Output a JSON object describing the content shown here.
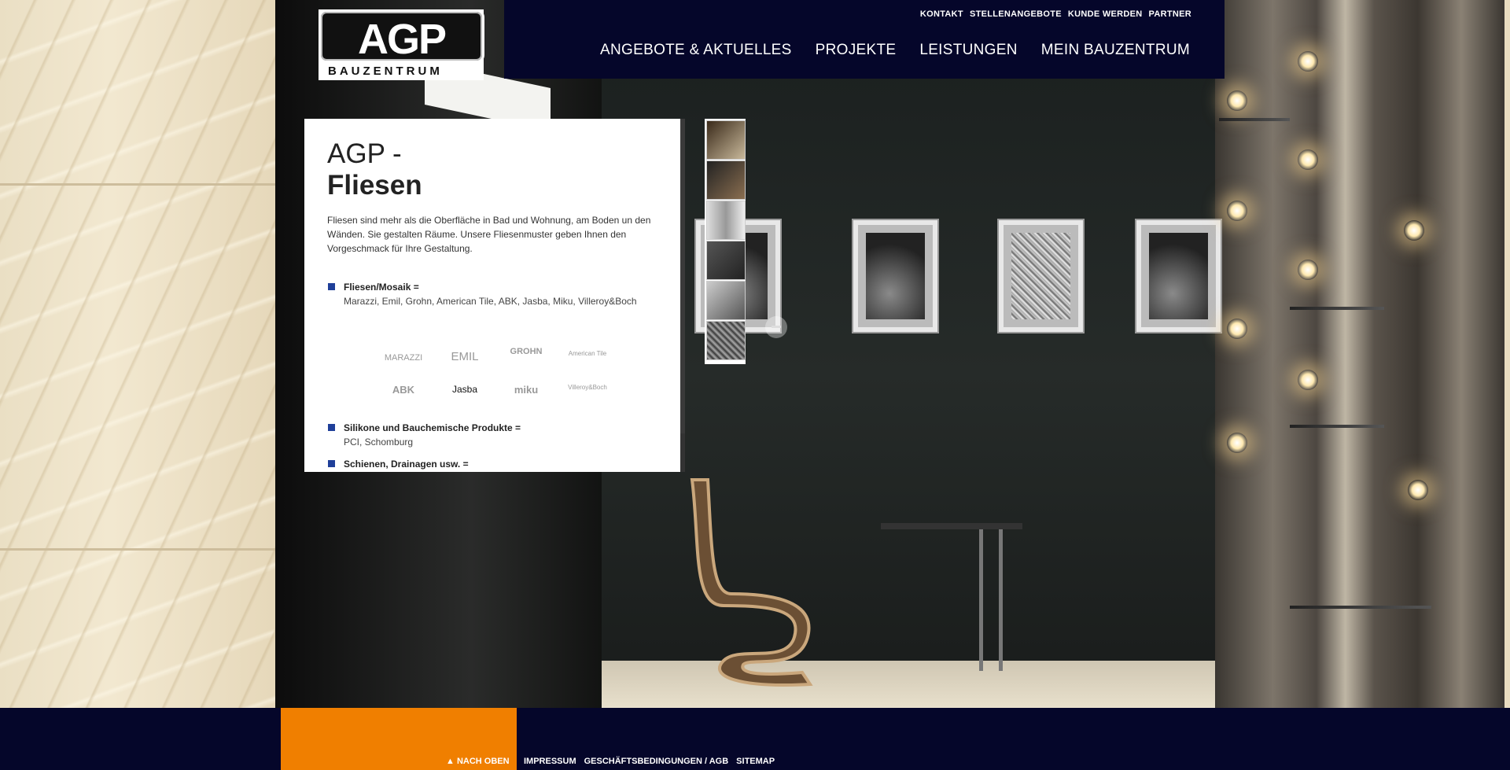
{
  "brand": {
    "logo_text": "AGP",
    "logo_sub": "BAUZENTRUM"
  },
  "topnav": [
    "KONTAKT",
    "STELLENANGEBOTE",
    "KUNDE WERDEN",
    "PARTNER"
  ],
  "mainnav": [
    "ANGEBOTE & AKTUELLES",
    "PROJEKTE",
    "LEISTUNGEN",
    "MEIN BAUZENTRUM"
  ],
  "panel": {
    "title_line1": "AGP -",
    "title_line2": "Fliesen",
    "intro": "Fliesen sind mehr als die Oberfläche in Bad und Wohnung, am Boden un den Wänden. Sie gestalten Räume. Unsere Fliesenmuster geben Ihnen den Vorgeschmack für Ihre Gestaltung.",
    "items": [
      {
        "title": "Fliesen/Mosaik =",
        "detail": "Marazzi, Emil, Grohn, American Tile, ABK, Jasba, Miku, Villeroy&Boch"
      },
      {
        "title": "Silikone und Bauchemische Produkte =",
        "detail": "PCI, Schomburg"
      },
      {
        "title": "Schienen, Drainagen usw. =",
        "detail": ""
      }
    ],
    "brands": [
      "MARAZZI",
      "EMIL",
      "GROHN",
      "American Tile",
      "ABK",
      "Jasba",
      "miku",
      "Villeroy&Boch"
    ]
  },
  "footer": {
    "up_label": "NACH OBEN",
    "links": [
      "IMPRESSUM",
      "GESCHÄFTSBEDINGUNGEN / AGB",
      "SITEMAP"
    ]
  },
  "colors": {
    "navy": "#05062a",
    "orange": "#f07f00",
    "bullet": "#1f3f99"
  },
  "icons": {
    "up": "chevron-up-icon",
    "slider_control": "minus-icon"
  }
}
